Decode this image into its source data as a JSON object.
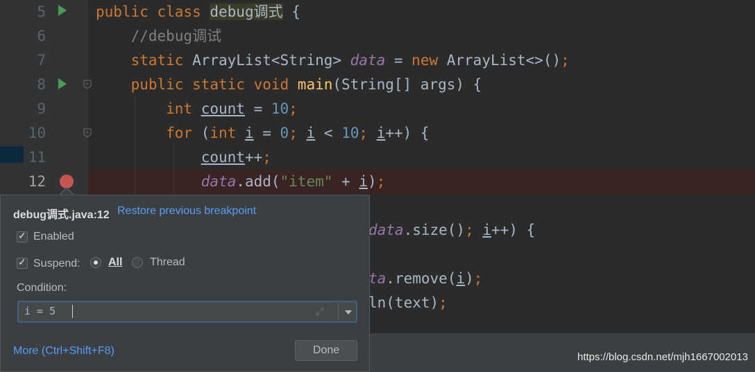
{
  "editor": {
    "line_numbers": [
      "5",
      "6",
      "7",
      "8",
      "9",
      "10",
      "11",
      "12"
    ],
    "lines": [
      [
        {
          "t": "public class ",
          "c": "kw"
        },
        {
          "t": "debug调式",
          "c": "hl"
        },
        {
          "t": " {",
          "c": ""
        }
      ],
      [
        {
          "t": "    //debug调试",
          "c": "cm"
        }
      ],
      [
        {
          "t": "    static ",
          "c": "kw"
        },
        {
          "t": "ArrayList<String> ",
          "c": ""
        },
        {
          "t": "data",
          "c": "fld"
        },
        {
          "t": " = ",
          "c": ""
        },
        {
          "t": "new ",
          "c": "kw"
        },
        {
          "t": "ArrayList<>()",
          "c": ""
        },
        {
          "t": ";",
          "c": "kw"
        }
      ],
      [
        {
          "t": "    public static void ",
          "c": "kw"
        },
        {
          "t": "main",
          "c": "fn"
        },
        {
          "t": "(String[] args) {",
          "c": ""
        }
      ],
      [
        {
          "t": "        int ",
          "c": "kw"
        },
        {
          "t": "count",
          "c": "ul"
        },
        {
          "t": " = ",
          "c": ""
        },
        {
          "t": "10",
          "c": "num"
        },
        {
          "t": ";",
          "c": "kw"
        }
      ],
      [
        {
          "t": "        for ",
          "c": "kw"
        },
        {
          "t": "(",
          "c": ""
        },
        {
          "t": "int ",
          "c": "kw"
        },
        {
          "t": "i",
          "c": "ul"
        },
        {
          "t": " = ",
          "c": ""
        },
        {
          "t": "0",
          "c": "num"
        },
        {
          "t": "; ",
          "c": "kw"
        },
        {
          "t": "i",
          "c": "ul"
        },
        {
          "t": " < ",
          "c": ""
        },
        {
          "t": "10",
          "c": "num"
        },
        {
          "t": "; ",
          "c": "kw"
        },
        {
          "t": "i",
          "c": "ul"
        },
        {
          "t": "++) {",
          "c": ""
        }
      ],
      [
        {
          "t": "            ",
          "c": ""
        },
        {
          "t": "count",
          "c": "ul"
        },
        {
          "t": "++",
          "c": ""
        },
        {
          "t": ";",
          "c": "kw"
        }
      ],
      [
        {
          "t": "            ",
          "c": ""
        },
        {
          "t": "data",
          "c": "fld"
        },
        {
          "t": ".add(",
          "c": ""
        },
        {
          "t": "\"item\"",
          "c": "str"
        },
        {
          "t": " + ",
          "c": ""
        },
        {
          "t": "i",
          "c": "ul"
        },
        {
          "t": ")",
          "c": ""
        },
        {
          "t": ";",
          "c": "kw"
        }
      ]
    ],
    "partial_lines": [
      [
        {
          "t": "data",
          "c": "fld"
        },
        {
          "t": ".size()",
          "c": ""
        },
        {
          "t": "; ",
          "c": "kw"
        },
        {
          "t": "i",
          "c": "ul"
        },
        {
          "t": "++) {",
          "c": ""
        }
      ],
      [
        {
          "t": "ta",
          "c": "fld"
        },
        {
          "t": ".remove(",
          "c": ""
        },
        {
          "t": "i",
          "c": "ul"
        },
        {
          "t": ")",
          "c": ""
        },
        {
          "t": ";",
          "c": "kw"
        }
      ],
      [
        {
          "t": "ln(text)",
          "c": ""
        },
        {
          "t": ";",
          "c": "kw"
        }
      ]
    ]
  },
  "popup": {
    "title": "debug调式.java:12",
    "restore_link": "Restore previous breakpoint",
    "enabled_label": "Enabled",
    "enabled_checked": true,
    "suspend_label": "Suspend:",
    "suspend_checked": true,
    "radio_all": "All",
    "radio_thread": "Thread",
    "selected_radio": "All",
    "condition_label": "Condition:",
    "condition_value": "i = 5",
    "more_link": "More (Ctrl+Shift+F8)",
    "done_button": "Done"
  },
  "icons": {
    "run": "run-gutter-icon",
    "breakpoint": "breakpoint-icon",
    "fold": "fold-marker-icon",
    "expand": "expand-icon",
    "dropdown": "dropdown-arrow-icon"
  },
  "watermark": "https://blog.csdn.net/mjh1667002013"
}
